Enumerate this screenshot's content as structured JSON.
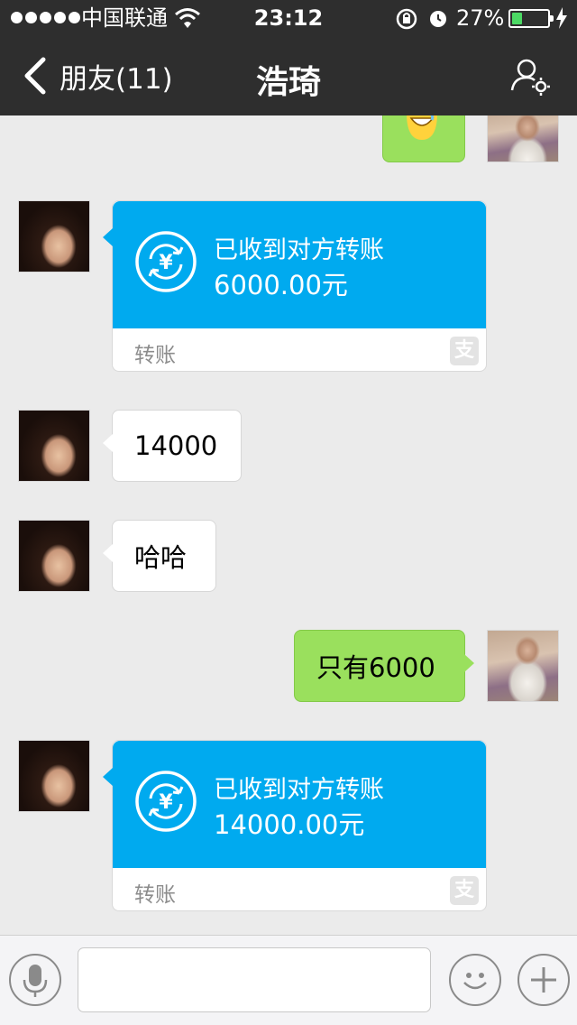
{
  "status_bar": {
    "carrier": "中国联通",
    "time": "23:12",
    "battery_percent": "27%",
    "battery_level": 0.27,
    "icons": [
      "signal-dots-icon",
      "wifi-icon",
      "rotation-lock-icon",
      "alarm-icon",
      "battery-icon",
      "charging-bolt-icon"
    ]
  },
  "nav": {
    "back_label": "朋友(11)",
    "title": "浩琦",
    "back_icon": "chevron-left-icon",
    "profile_icon": "user-settings-icon"
  },
  "messages": {
    "transfer_1": {
      "title": "已收到对方转账",
      "amount": "6000.00元",
      "footer": "转账"
    },
    "text_1": {
      "text": "14000"
    },
    "text_2": {
      "text": "哈哈"
    },
    "text_3": {
      "text": "只有6000"
    },
    "transfer_2": {
      "title": "已收到对方转账",
      "amount": "14000.00元",
      "footer": "转账"
    }
  },
  "input_bar": {
    "placeholder": "",
    "voice_icon": "microphone-icon",
    "emoji_icon": "smiley-icon",
    "plus_icon": "plus-icon"
  },
  "colors": {
    "navbar": "#2e2e2e",
    "background": "#ebebeb",
    "outgoing_bubble": "#9ae05d",
    "transfer_card": "#00aaef",
    "battery_fill": "#4cd964"
  }
}
